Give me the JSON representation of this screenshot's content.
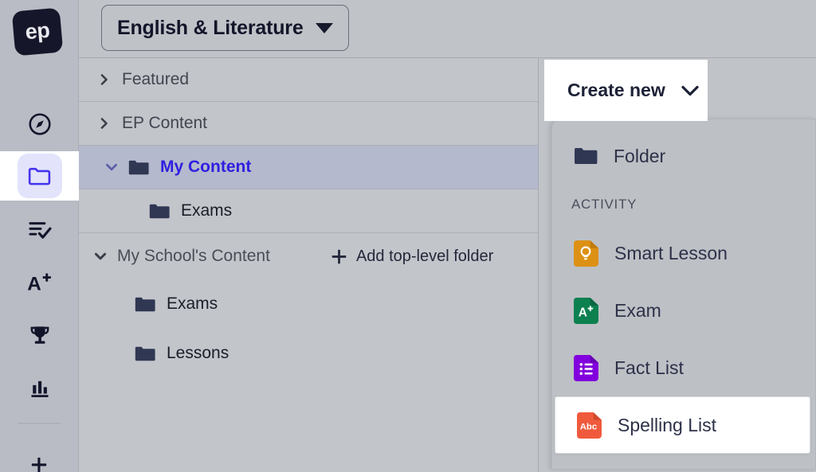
{
  "brand": {
    "logo_text": "ep",
    "logo_bg": "#16162b",
    "accent": "#2f1fe0"
  },
  "rail": {
    "items": [
      {
        "name": "explore",
        "icon": "compass-icon",
        "active": false
      },
      {
        "name": "content",
        "icon": "folder-icon",
        "active": true
      },
      {
        "name": "assignments",
        "icon": "list-check-icon",
        "active": false
      },
      {
        "name": "grades",
        "icon": "a-plus-icon",
        "active": false
      },
      {
        "name": "awards",
        "icon": "trophy-icon",
        "active": false
      },
      {
        "name": "reports",
        "icon": "bar-chart-icon",
        "active": false
      },
      {
        "name": "add",
        "icon": "plus-icon",
        "active": false
      }
    ]
  },
  "topbar": {
    "subject_label": "English & Literature",
    "subject_caret": "chevron-down-icon"
  },
  "tree": {
    "rows": [
      {
        "label": "Featured",
        "icon": "chevron-right-icon",
        "expanded": false,
        "selected": false,
        "depth": 0
      },
      {
        "label": "EP Content",
        "icon": "chevron-right-icon",
        "expanded": false,
        "selected": false,
        "depth": 0
      },
      {
        "label": "My Content",
        "icon": "chevron-down-icon",
        "expanded": true,
        "selected": true,
        "depth": 0
      },
      {
        "label": "Exams",
        "icon": "folder-icon",
        "expanded": false,
        "selected": false,
        "depth": 1
      }
    ],
    "section": {
      "label": "My School's Content",
      "chevron": "chevron-down-icon",
      "add_label": "Add top-level folder",
      "add_icon": "plus-icon",
      "children": [
        {
          "label": "Exams",
          "icon": "folder-icon"
        },
        {
          "label": "Lessons",
          "icon": "folder-icon"
        }
      ]
    }
  },
  "create_menu": {
    "button_label": "Create new",
    "button_caret": "chevron-down-icon",
    "folder_item": {
      "label": "Folder",
      "icon": "folder-icon"
    },
    "group_label": "ACTIVITY",
    "items": [
      {
        "label": "Smart Lesson",
        "icon": "lightbulb-doc-icon",
        "color": "#dd9114",
        "highlight": false
      },
      {
        "label": "Exam",
        "icon": "a-plus-doc-icon",
        "color": "#0d8050",
        "highlight": false
      },
      {
        "label": "Fact List",
        "icon": "list-doc-icon",
        "color": "#8200dd",
        "highlight": false
      },
      {
        "label": "Spelling List",
        "icon": "abc-doc-icon",
        "color": "#f05a3c",
        "highlight": true
      }
    ]
  }
}
